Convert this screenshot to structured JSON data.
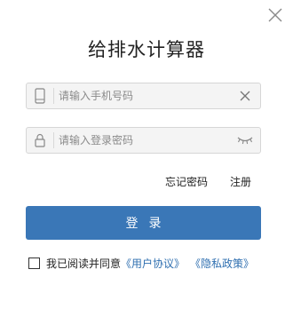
{
  "dialog": {
    "title": "给排水计算器",
    "close_icon": "close-icon"
  },
  "phone_field": {
    "icon": "phone-icon",
    "placeholder": "请输入手机号码",
    "value": "",
    "clear_icon": "clear-icon"
  },
  "password_field": {
    "icon": "lock-icon",
    "placeholder": "请输入登录密码",
    "value": "",
    "visibility_icon": "eye-closed-icon"
  },
  "links": {
    "forgot_password": "忘记密码",
    "register": "注册"
  },
  "login_button": {
    "label": "登录"
  },
  "agreement": {
    "checked": false,
    "text": "我已阅读并同意",
    "user_agreement": "《用户协议》",
    "privacy_policy": "《隐私政策》"
  },
  "colors": {
    "accent": "#3a77b7",
    "link": "#2f6fb0",
    "field_bg": "#f4f4f4"
  }
}
